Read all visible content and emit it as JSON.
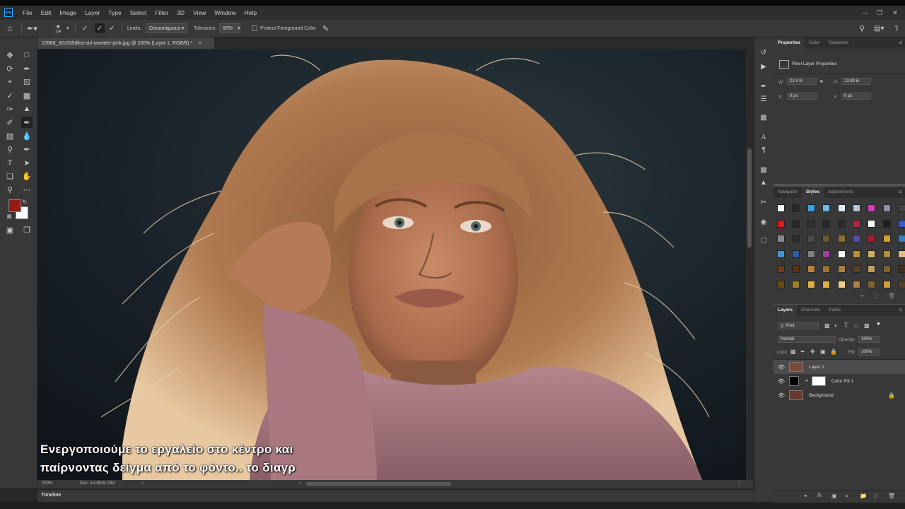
{
  "app": {
    "logo": "Ps",
    "menu": [
      "File",
      "Edit",
      "Image",
      "Layer",
      "Type",
      "Select",
      "Filter",
      "3D",
      "View",
      "Window",
      "Help"
    ]
  },
  "options": {
    "brush_size": "134",
    "limits_label": "Limits:",
    "limits_value": "Discontiguous",
    "tolerance_label": "Tolerance:",
    "tolerance_value": "50%",
    "protect_label": "Protect Foreground Color"
  },
  "document": {
    "tab_title": "10960_32c635dfea-siri-sweater-pink.jpg @ 200% (Layer 1, RGB/8) *",
    "zoom": "200%",
    "doc_info": "Doc: 4.61M/9.23M"
  },
  "subtitles": {
    "line1": "Ενεργοποιούμε το εργαλείο στο κέντρο και",
    "line2": "παίρνοντας δείγμα από το φόντο.. το διαγρ"
  },
  "timeline_label": "Timeline",
  "properties": {
    "tabs": [
      "Properties",
      "Color",
      "Swatches"
    ],
    "header": "Pixel Layer Properties",
    "w_label": "W:",
    "w_value": "22.4 in",
    "h_label": "H:",
    "h_value": "13.89 in",
    "x_label": "X:",
    "x_value": "0 px",
    "y_label": "Y:",
    "y_value": "0 px"
  },
  "styles_panel": {
    "tabs": [
      "Navigator",
      "Styles",
      "Adjustments"
    ],
    "swatch_colors": [
      [
        "#ffffff",
        "#2a2a2a",
        "#3aa0e0",
        "#6fb8ea",
        "#dfeaf5",
        "#b4c4d8",
        "#d040c0",
        "#9090a0",
        "#444444"
      ],
      [
        "#d02020",
        "#2b2b2b",
        "#303030",
        "#2a2a2a",
        "#2c2c2c",
        "#c02040",
        "#ffffff",
        "#202020",
        "#3060c0"
      ],
      [
        "#888888",
        "#2c2c2c",
        "#4a4a4a",
        "#6a5a30",
        "#8a7030",
        "#5050a0",
        "#a02030",
        "#d0a030",
        "#3080c0"
      ],
      [
        "#4a90d0",
        "#3060a0",
        "#808080",
        "#a040a0",
        "#ffffff",
        "#c09030",
        "#d0b060",
        "#b09040",
        "#e0c080"
      ],
      [
        "#6a3a20",
        "#5a3010",
        "#c08030",
        "#a07030",
        "#b08040",
        "#5a4020",
        "#c0a060",
        "#806030",
        "#403020"
      ],
      [
        "#6a4a10",
        "#a08020",
        "#e0b040",
        "#e0b040",
        "#f0d080",
        "#b08040",
        "#806030",
        "#d0a030",
        "#504020"
      ]
    ]
  },
  "layers_panel": {
    "tabs": [
      "Layers",
      "Channels",
      "Paths"
    ],
    "kind_label": "Kind",
    "blend_mode": "Normal",
    "opacity_label": "Opacity:",
    "opacity_value": "100%",
    "lock_label": "Lock:",
    "fill_label": "Fill:",
    "fill_value": "100%",
    "layers": [
      {
        "name": "Layer 1",
        "selected": true
      },
      {
        "name": "Color Fill 1",
        "selected": false
      },
      {
        "name": "Background",
        "selected": false
      }
    ]
  },
  "colors": {
    "foreground": "#9a1a14",
    "background": "#ffffff",
    "ui_dark": "#383838",
    "selection": "#4b4b4b"
  }
}
